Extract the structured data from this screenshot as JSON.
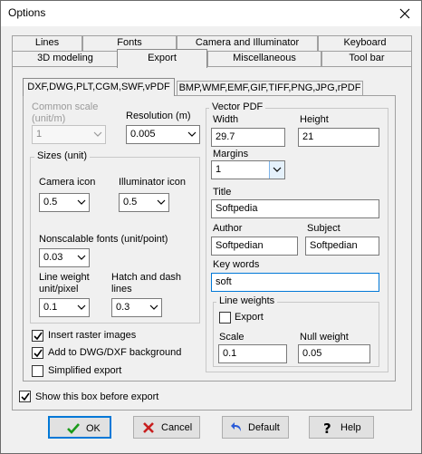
{
  "window": {
    "title": "Options"
  },
  "tabs_row1": [
    "Lines",
    "Fonts",
    "Camera and Illuminator",
    "Keyboard"
  ],
  "tabs_row2": [
    "3D modeling",
    "Export",
    "Miscellaneous",
    "Tool bar"
  ],
  "subtabs": [
    "DXF,DWG,PLT,CGM,SWF,vPDF",
    "BMP,WMF,EMF,GIF,TIFF,PNG,JPG,rPDF"
  ],
  "common_scale": {
    "label": "Common scale (unit/m)",
    "value": "1"
  },
  "resolution": {
    "label": "Resolution (m)",
    "value": "0.005"
  },
  "sizes": {
    "title": "Sizes (unit)",
    "camera_icon_label": "Camera icon",
    "camera_icon_value": "0.5",
    "illuminator_icon_label": "Illuminator icon",
    "illuminator_icon_value": "0.5",
    "nonscalable_label": "Nonscalable fonts (unit/point)",
    "nonscalable_value": "0.03",
    "line_weight_label": "Line weight unit/pixel",
    "line_weight_value": "0.1",
    "hatch_label": "Hatch and dash lines",
    "hatch_value": "0.3"
  },
  "checks": {
    "insert_raster": "Insert raster images",
    "add_dwg_bg": "Add to DWG/DXF background",
    "simplified": "Simplified export",
    "show_box": "Show this box before export"
  },
  "vector_pdf": {
    "title": "Vector PDF",
    "width_label": "Width",
    "width_value": "29.7",
    "height_label": "Height",
    "height_value": "21",
    "margins_label": "Margins",
    "margins_value": "1",
    "title_label": "Title",
    "title_value": "Softpedia",
    "author_label": "Author",
    "author_value": "Softpedian",
    "subject_label": "Subject",
    "subject_value": "Softpedian",
    "keywords_label": "Key words",
    "keywords_value": "soft",
    "line_weights": {
      "title": "Line weights",
      "export_label": "Export",
      "scale_label": "Scale",
      "scale_value": "0.1",
      "null_label": "Null weight",
      "null_value": "0.05"
    }
  },
  "buttons": {
    "ok": "OK",
    "cancel": "Cancel",
    "default": "Default",
    "help": "Help"
  },
  "icons": [
    "close-icon",
    "dropdown-arrow-icon",
    "checkmark-icon",
    "ok-check-icon",
    "cancel-x-icon",
    "default-arrow-icon",
    "help-question-icon"
  ]
}
